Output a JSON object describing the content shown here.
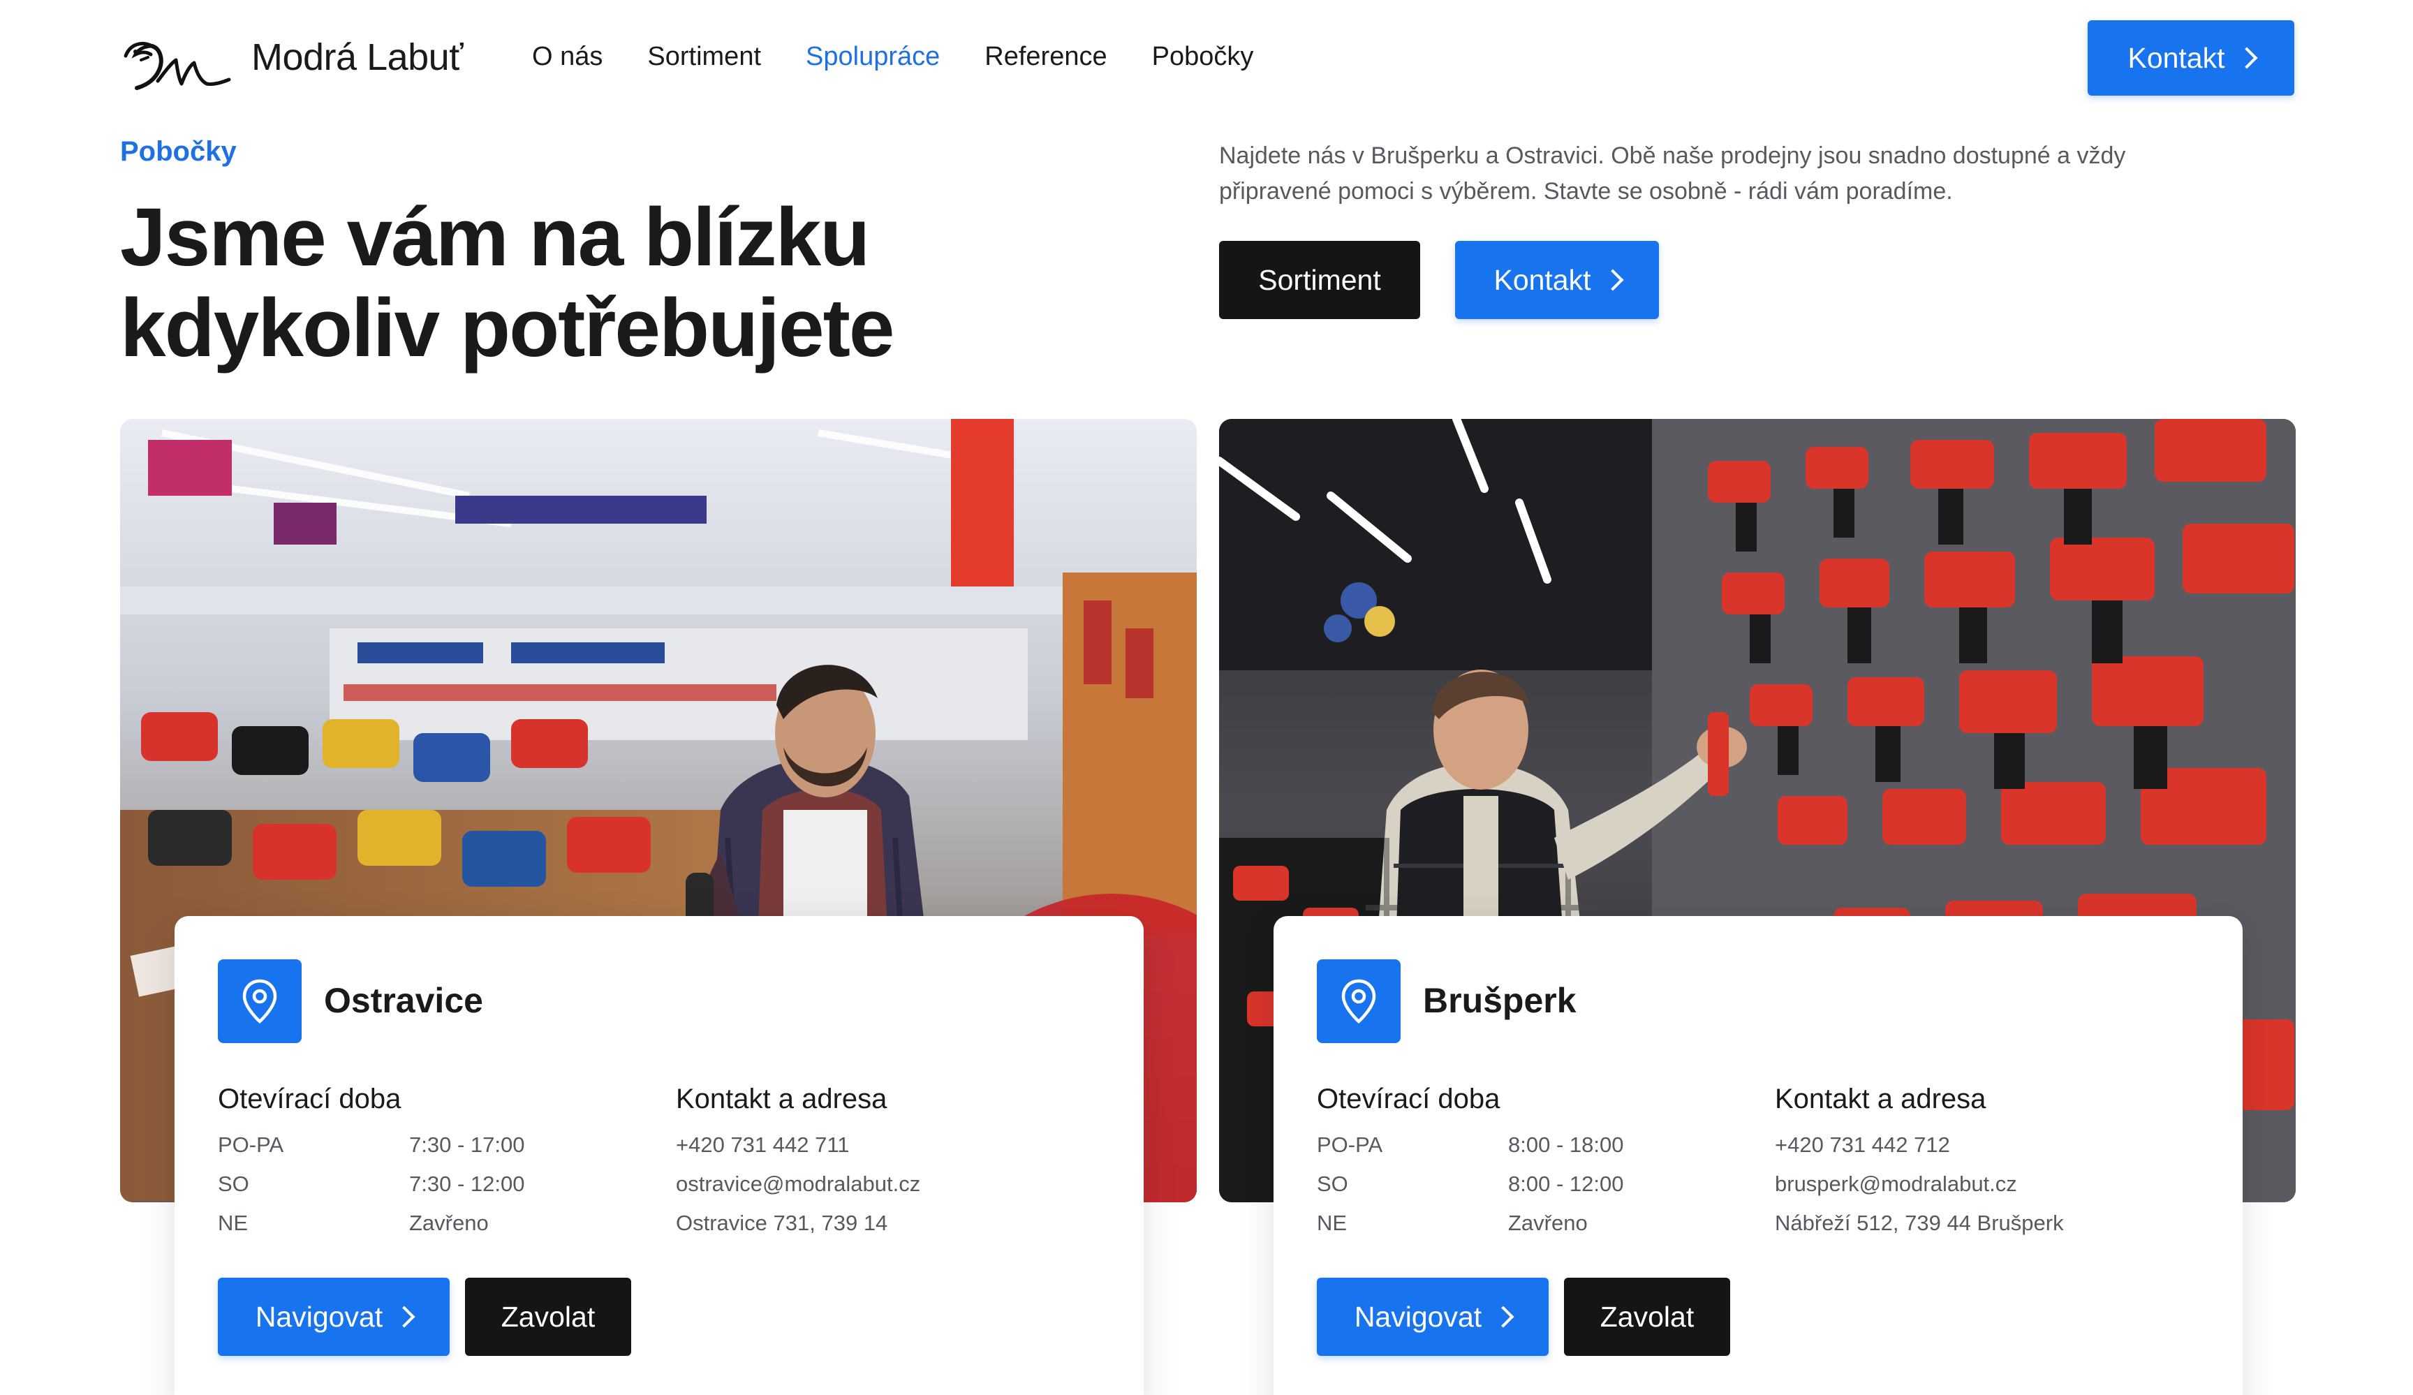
{
  "brand": {
    "name": "Modrá Labuť"
  },
  "nav": {
    "items": [
      {
        "label": "O nás",
        "active": false
      },
      {
        "label": "Sortiment",
        "active": false
      },
      {
        "label": "Spolupráce",
        "active": true
      },
      {
        "label": "Reference",
        "active": false
      },
      {
        "label": "Pobočky",
        "active": false
      }
    ],
    "cta_label": "Kontakt"
  },
  "hero": {
    "eyebrow": "Pobočky",
    "title_line1": "Jsme vám na blízku",
    "title_line2": "kdykoliv potřebujete",
    "description": "Najdete nás v Brušperku a Ostravici. Obě naše prodejny jsou snadno dostupné a vždy připravené pomoci s výběrem. Stavte se osobně - rádi vám poradíme.",
    "btn_primary": "Sortiment",
    "btn_secondary": "Kontakt"
  },
  "branches": [
    {
      "name": "Ostravice",
      "hours_title": "Otevírací doba",
      "hours": [
        {
          "day": "PO-PA",
          "time": "7:30 - 17:00"
        },
        {
          "day": "SO",
          "time": "7:30 - 12:00"
        },
        {
          "day": "NE",
          "time": "Zavřeno"
        }
      ],
      "contact_title": "Kontakt a adresa",
      "phone": "+420 731 442 711",
      "email": "ostravice@modralabut.cz",
      "address": "Ostravice 731, 739 14",
      "btn_navigate": "Navigovat",
      "btn_call": "Zavolat"
    },
    {
      "name": "Brušperk",
      "hours_title": "Otevírací doba",
      "hours": [
        {
          "day": "PO-PA",
          "time": "8:00 - 18:00"
        },
        {
          "day": "SO",
          "time": "8:00 - 12:00"
        },
        {
          "day": "NE",
          "time": "Zavřeno"
        }
      ],
      "contact_title": "Kontakt a adresa",
      "phone": "+420 731 442 712",
      "email": "brusperk@modralabut.cz",
      "address": "Nábřeží 512, 739 44 Brušperk",
      "btn_navigate": "Navigovat",
      "btn_call": "Zavolat"
    }
  ],
  "colors": {
    "accent": "#1873ef",
    "link": "#1f6fe5",
    "dark": "#151515",
    "text_muted": "#555a60"
  },
  "icons": {
    "location": "map-pin-icon",
    "chevron": "chevron-right-icon",
    "logo": "swan-logo-icon"
  }
}
